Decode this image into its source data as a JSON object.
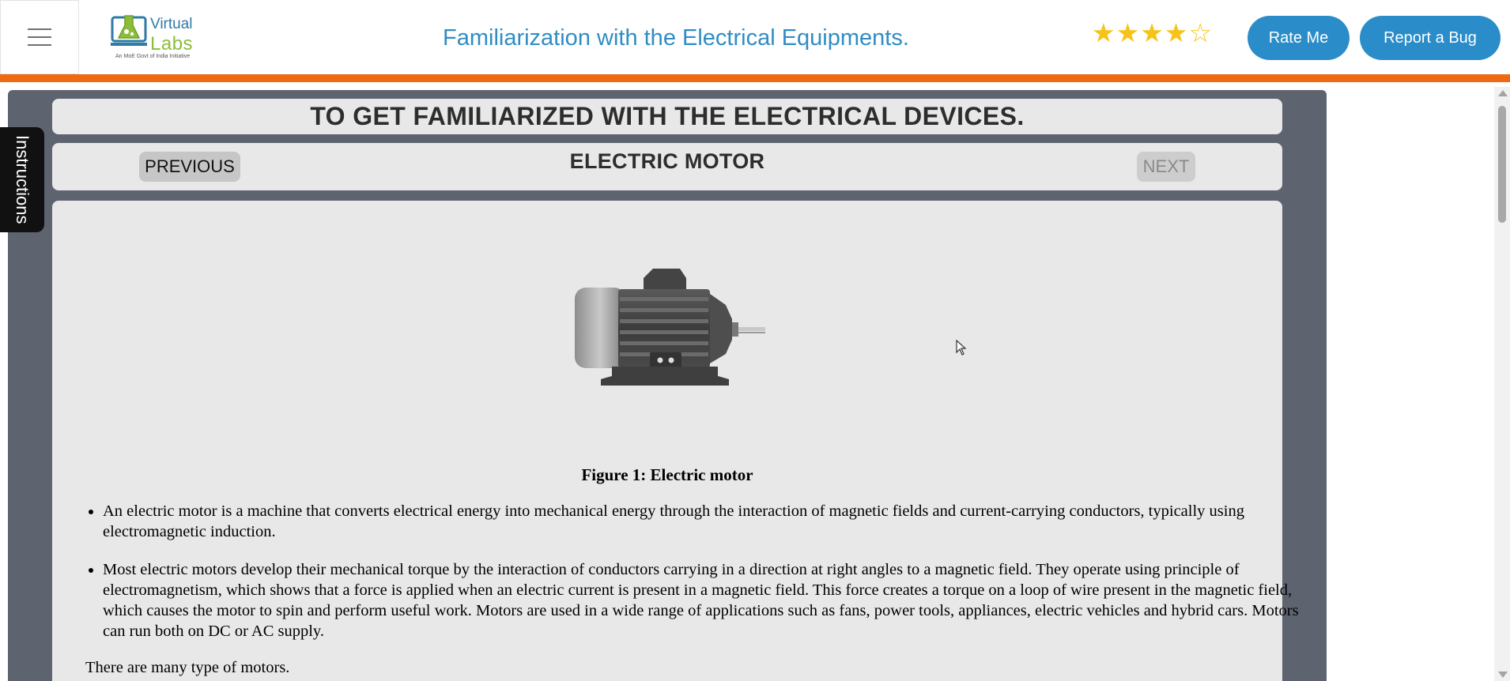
{
  "header": {
    "menu_icon": "hamburger-menu-icon",
    "logo": {
      "text_virtual": "Virtual",
      "text_labs": "Labs",
      "subtitle": "An MoE Govt of India Initiative"
    },
    "title": "Familiarization with the Electrical Equipments.",
    "rating": {
      "value": 4,
      "max": 5
    },
    "rate_button": "Rate Me",
    "bug_button": "Report a Bug",
    "accent_color": "#2a8dc9",
    "bar_color": "#ee6a12"
  },
  "sidebar": {
    "instructions_label": "Instructions"
  },
  "main": {
    "heading": "TO GET FAMILIARIZED WITH THE ELECTRICAL DEVICES.",
    "nav": {
      "previous_label": "PREVIOUS",
      "next_label": "NEXT",
      "current_title": "ELECTRIC MOTOR"
    },
    "figure_caption": "Figure 1: Electric motor",
    "bullets": [
      "An electric motor is a machine that converts electrical energy into mechanical energy through the interaction of magnetic fields and current-carrying conductors, typically using electromagnetic induction.",
      "Most electric motors develop their mechanical torque by the interaction of conductors carrying in a direction at right angles to a magnetic field. They operate using principle of electromagnetism, which shows that a force is applied when an electric current is present in a magnetic field. This force creates a torque on a loop of wire present in the magnetic field, which causes the motor to spin and perform useful work. Motors are used in a wide range of applications such as fans, power tools, appliances, electric vehicles and hybrid cars. Motors can run both on DC or AC supply."
    ],
    "trailing_text": "There are many type of motors."
  }
}
